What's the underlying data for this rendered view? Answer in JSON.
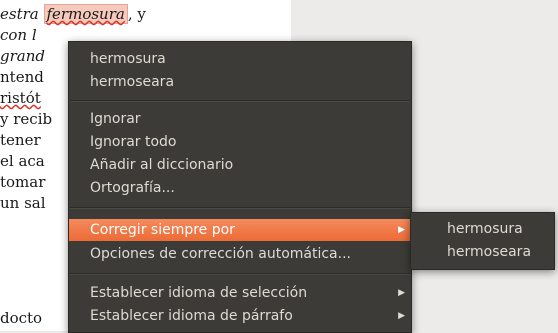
{
  "document": {
    "lines": [
      "estra",
      "con l",
      "grand",
      "ntend",
      "ristót",
      "y recib",
      "tener",
      "el aca",
      "tomar",
      "un sal",
      "docto"
    ],
    "misspelled_word": "fermosura",
    "after_word": ", y"
  },
  "context_menu": {
    "suggestions": [
      "hermosura",
      "hermoseara"
    ],
    "ignore": "Ignorar",
    "ignore_all": "Ignorar todo",
    "add_dictionary": "Añadir al diccionario",
    "spelling": "Ortografía...",
    "always_correct": "Corregir siempre por",
    "autocorrect_options": "Opciones de corrección automática...",
    "set_selection_language": "Establecer idioma de selección",
    "set_paragraph_language": "Establecer idioma de párrafo"
  },
  "submenu": {
    "items": [
      "hermosura",
      "hermoseara"
    ]
  },
  "colors": {
    "menu_bg": "#3c3b37",
    "highlight": "#f07746",
    "menu_text": "#dfdbd2"
  }
}
